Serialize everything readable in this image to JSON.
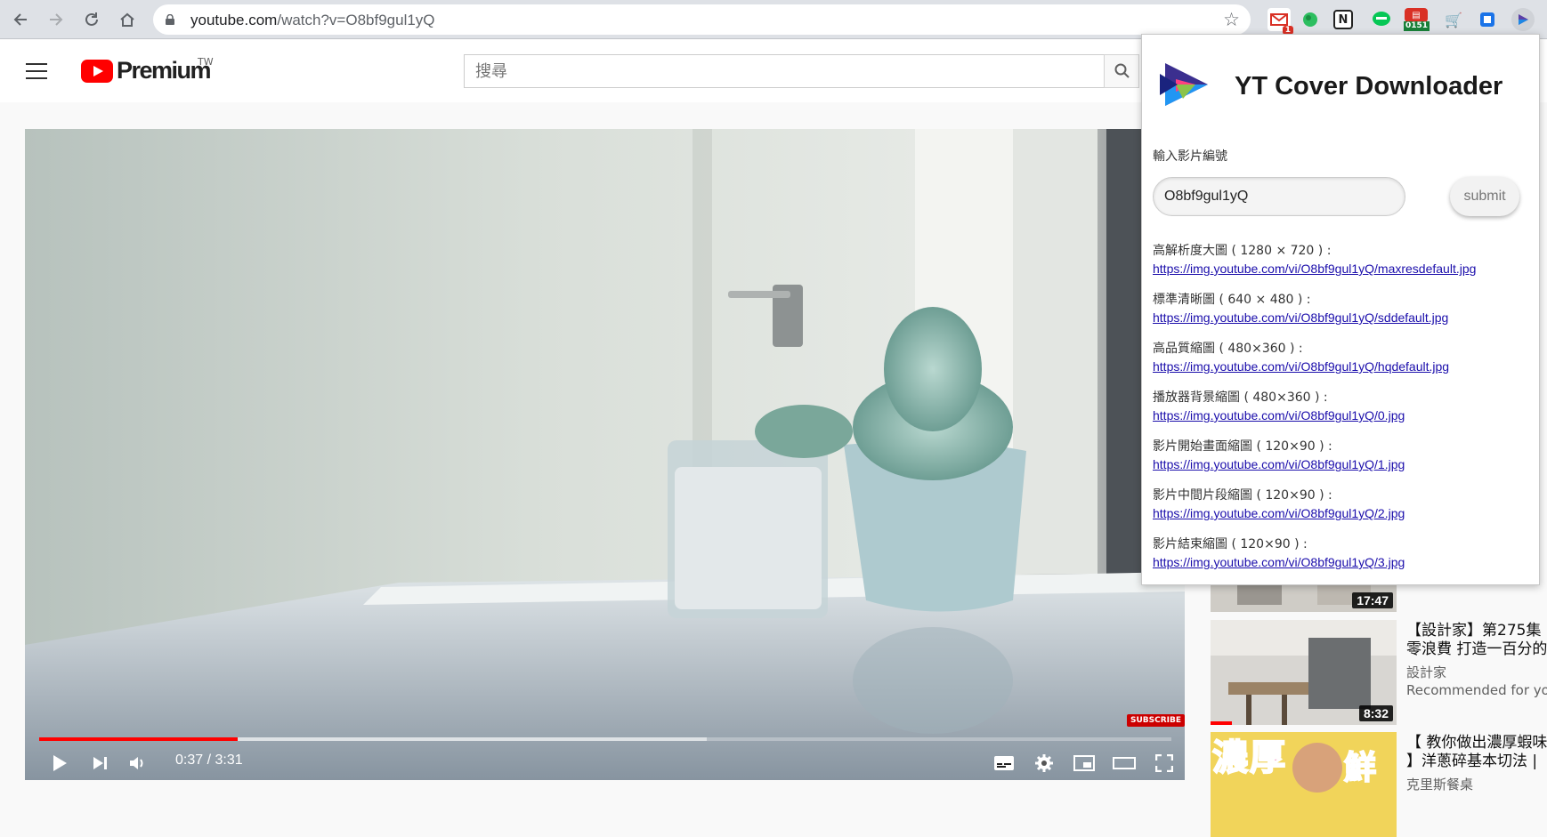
{
  "browser": {
    "url_prefix": "youtube.com",
    "url_path": "/watch?v=O8bf9gul1yQ",
    "extensions": [
      {
        "name": "gmail-extension-icon",
        "badge": "1"
      },
      {
        "name": "evernote-extension-icon",
        "badge": ""
      },
      {
        "name": "notion-extension-icon",
        "badge": ""
      },
      {
        "name": "line-extension-icon",
        "badge": ""
      },
      {
        "name": "calendar-extension-icon",
        "badge": "0151"
      },
      {
        "name": "cart-extension-icon",
        "badge": ""
      },
      {
        "name": "translate-extension-icon",
        "badge": ""
      },
      {
        "name": "yt-cover-downloader-extension-icon",
        "badge": ""
      }
    ]
  },
  "youtube": {
    "brand": "Premium",
    "region": "TW",
    "search_placeholder": "搜尋"
  },
  "player": {
    "time": "0:37 / 3:31",
    "progress_fraction": 0.175,
    "buffered_fraction": 0.59,
    "subscribe_label": "SUBSCRIBE"
  },
  "recommendations": [
    {
      "title": "",
      "channel": "",
      "meta": "",
      "duration": "17:47"
    },
    {
      "title": "【設計家】第275集 零浪費 打造一百分的",
      "channel": "設計家",
      "meta": "Recommended for you",
      "duration": "8:32"
    },
    {
      "title": "【 教你做出濃厚蝦味 】洋蔥碎基本切法 |",
      "channel": "克里斯餐桌",
      "meta": "",
      "duration": ""
    }
  ],
  "popup": {
    "title": "YT Cover Downloader",
    "input_label": "輸入影片編號",
    "input_value": "O8bf9gul1yQ",
    "submit_label": "submit",
    "links": [
      {
        "label": "高解析度大圖 ( 1280 × 720 ) :",
        "url": "https://img.youtube.com/vi/O8bf9gul1yQ/maxresdefault.jpg"
      },
      {
        "label": "標準清晰圖 ( 640 × 480 ) :",
        "url": "https://img.youtube.com/vi/O8bf9gul1yQ/sddefault.jpg"
      },
      {
        "label": "高品質縮圖 ( 480×360 ) :",
        "url": "https://img.youtube.com/vi/O8bf9gul1yQ/hqdefault.jpg"
      },
      {
        "label": "播放器背景縮圖 ( 480×360 ) :",
        "url": "https://img.youtube.com/vi/O8bf9gul1yQ/0.jpg"
      },
      {
        "label": "影片開始畫面縮圖 ( 120×90 ) :",
        "url": "https://img.youtube.com/vi/O8bf9gul1yQ/1.jpg"
      },
      {
        "label": "影片中間片段縮圖 ( 120×90 ) :",
        "url": "https://img.youtube.com/vi/O8bf9gul1yQ/2.jpg"
      },
      {
        "label": "影片結束縮圖 ( 120×90 ) :",
        "url": "https://img.youtube.com/vi/O8bf9gul1yQ/3.jpg"
      }
    ]
  },
  "colors": {
    "accent_red": "#ff0000",
    "link_blue": "#1a0dab"
  }
}
